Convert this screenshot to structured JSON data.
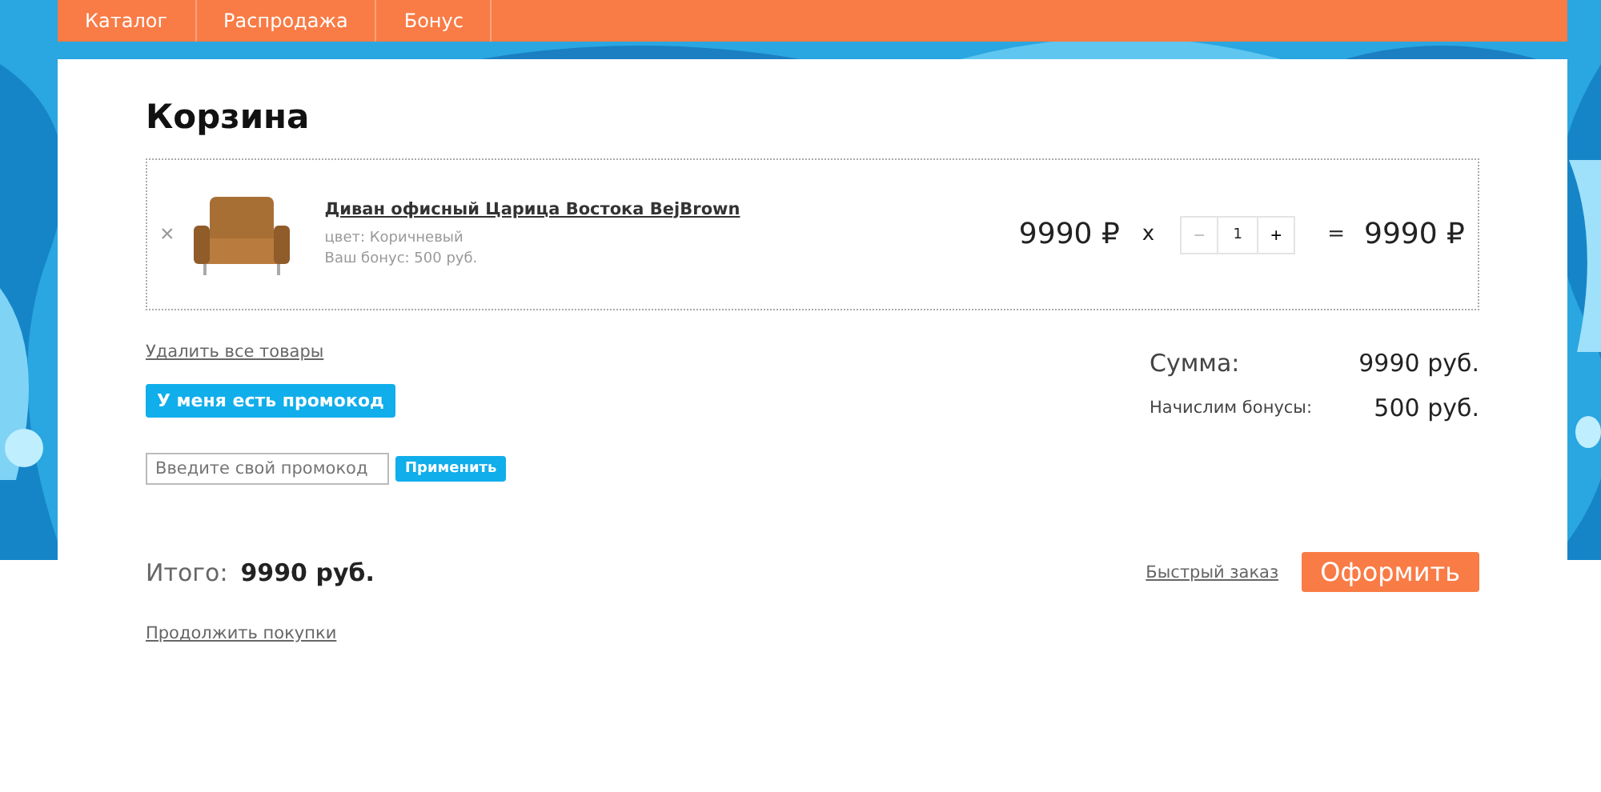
{
  "nav": [
    {
      "label": "Каталог"
    },
    {
      "label": "Распродажа"
    },
    {
      "label": "Бонус"
    }
  ],
  "title": "Корзина",
  "items": [
    {
      "remove": "×",
      "name": "Диван офисный Царица Востока BejBrown",
      "color_line": "цвет: Коричневый",
      "bonus_line": "Ваш бонус: 500 руб.",
      "price": "9990 ₽",
      "times": "x",
      "minus": "−",
      "qty": "1",
      "plus": "+",
      "equals": "=",
      "total": "9990 ₽"
    }
  ],
  "remove_all": "Удалить все товары",
  "promo_button": "У меня есть промокод",
  "promo_field": {
    "placeholder": "Введите свой промокод"
  },
  "apply_button": "Применить",
  "summary": [
    {
      "label": "Сумма:",
      "value": "9990 руб.",
      "kind": "sum"
    },
    {
      "label": "Начислим бонусы:",
      "value": "500 руб.",
      "kind": "bonus"
    }
  ],
  "total_label": "Итого:",
  "total_value": "9990 руб.",
  "quick_order": "Быстрый заказ",
  "checkout": "Оформить",
  "continue": "Продолжить покупки"
}
